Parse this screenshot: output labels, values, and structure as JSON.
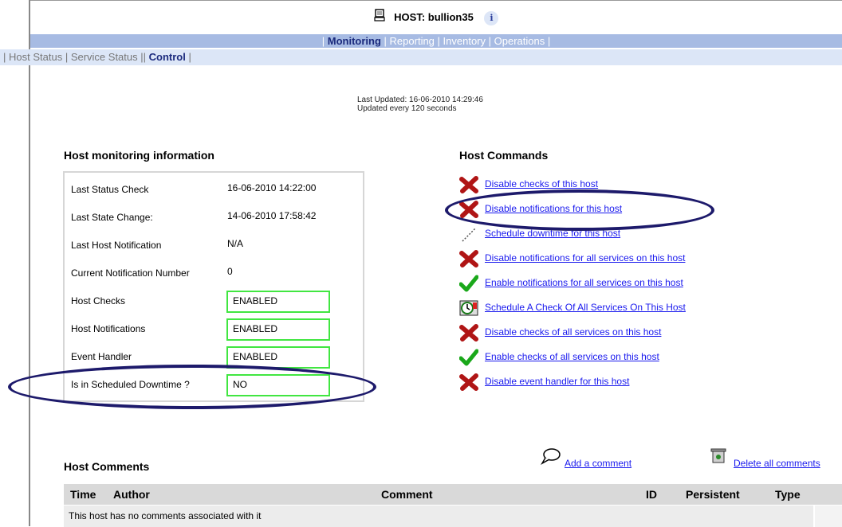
{
  "header": {
    "title": "HOST: bullion35",
    "info_glyph": "i"
  },
  "topnav": {
    "items": [
      "Monitoring",
      "Reporting",
      "Inventory",
      "Operations"
    ]
  },
  "subnav": {
    "items": [
      "Host Status",
      "Service Status",
      "Control"
    ]
  },
  "update": {
    "last_updated": "Last Updated: 16-06-2010 14:29:46",
    "interval": "Updated every 120 seconds"
  },
  "monitoring": {
    "title": "Host monitoring information",
    "rows": [
      {
        "label": "Last Status Check",
        "value": "16-06-2010 14:22:00"
      },
      {
        "label": "Last State Change:",
        "value": "14-06-2010 17:58:42"
      },
      {
        "label": "Last Host Notification",
        "value": "N/A"
      },
      {
        "label": "Current Notification Number",
        "value": "0"
      },
      {
        "label": "Host Checks",
        "value": "ENABLED"
      },
      {
        "label": "Host Notifications",
        "value": "ENABLED"
      },
      {
        "label": "Event Handler",
        "value": "ENABLED"
      },
      {
        "label": "Is in Scheduled Downtime ?",
        "value": "NO"
      }
    ]
  },
  "commands": {
    "title": "Host Commands",
    "items": [
      {
        "label": "Disable checks of this host",
        "icon": "red-x-icon"
      },
      {
        "label": "Disable notifications for this host",
        "icon": "red-x-icon"
      },
      {
        "label": "Schedule downtime for this host",
        "icon": "downtime-icon"
      },
      {
        "label": "Disable notifications for all services on this host",
        "icon": "red-x-icon"
      },
      {
        "label": "Enable notifications for all services on this host",
        "icon": "green-check-icon"
      },
      {
        "label": "Schedule A Check Of All Services On This Host",
        "icon": "clock-icon"
      },
      {
        "label": "Disable checks of all services on this host",
        "icon": "red-x-icon"
      },
      {
        "label": "Enable checks of all services on this host",
        "icon": "green-check-icon"
      },
      {
        "label": "Disable event handler for this host",
        "icon": "red-x-icon"
      }
    ]
  },
  "comments": {
    "title": "Host Comments",
    "add_label": "Add a comment",
    "delete_label": "Delete all comments",
    "columns": [
      "Time",
      "Author",
      "Comment",
      "ID",
      "Persistent",
      "Type"
    ],
    "empty_message": "This host has no comments associated with it"
  },
  "colors": {
    "nav_bar": "#a7bbe3",
    "subnav_bar": "#dce6f7",
    "enabled_border": "#41e641",
    "highlight_oval": "#1d1a6b",
    "link": "#1a1aee"
  }
}
